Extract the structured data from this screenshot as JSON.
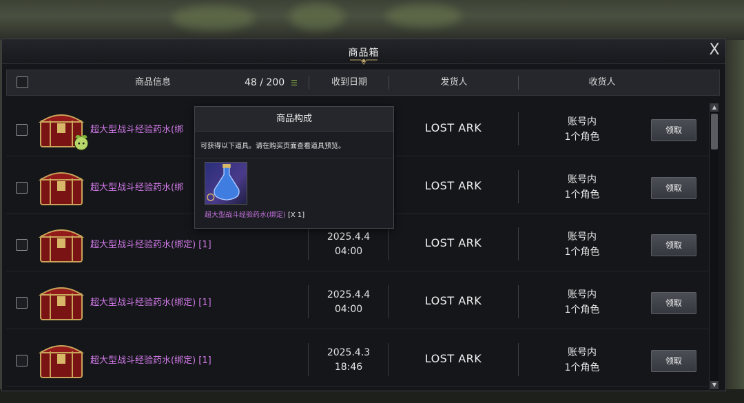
{
  "window": {
    "title": "商品箱",
    "close_label": "X"
  },
  "header": {
    "item_info": "商品信息",
    "capacity": "48 / 200",
    "date": "收到日期",
    "sender": "发货人",
    "receiver": "收货人"
  },
  "rows": [
    {
      "name": "超大型战斗经验药水(绑",
      "date_line1": "",
      "date_line2": "",
      "sender": "LOST ARK",
      "receiver_line1": "账号内",
      "receiver_line2": "1个角色",
      "claim": "领取"
    },
    {
      "name": "超大型战斗经验药水(绑",
      "date_line1": "",
      "date_line2": "",
      "sender": "LOST ARK",
      "receiver_line1": "账号内",
      "receiver_line2": "1个角色",
      "claim": "领取"
    },
    {
      "name": "超大型战斗经验药水(绑定) [1]",
      "date_line1": "2025.4.4",
      "date_line2": "04:00",
      "sender": "LOST ARK",
      "receiver_line1": "账号内",
      "receiver_line2": "1个角色",
      "claim": "领取"
    },
    {
      "name": "超大型战斗经验药水(绑定) [1]",
      "date_line1": "2025.4.4",
      "date_line2": "04:00",
      "sender": "LOST ARK",
      "receiver_line1": "账号内",
      "receiver_line2": "1个角色",
      "claim": "领取"
    },
    {
      "name": "超大型战斗经验药水(绑定) [1]",
      "date_line1": "2025.4.3",
      "date_line2": "18:46",
      "sender": "LOST ARK",
      "receiver_line1": "账号内",
      "receiver_line2": "1个角色",
      "claim": "领取"
    }
  ],
  "popup": {
    "title": "商品构成",
    "description": "可获得以下道具。请在购买页面查看道具预览。",
    "item_name": "超大型战斗经验药水(绑定)",
    "item_qty": " [X 1]"
  },
  "colors": {
    "item_name": "#d27ae8",
    "window_bg": "#14161a",
    "button_bg": "#41444b"
  },
  "icons": {
    "close": "close-icon",
    "chest": "treasure-chest-icon",
    "bound": "bound-leaf-icon",
    "potion": "potion-icon"
  }
}
